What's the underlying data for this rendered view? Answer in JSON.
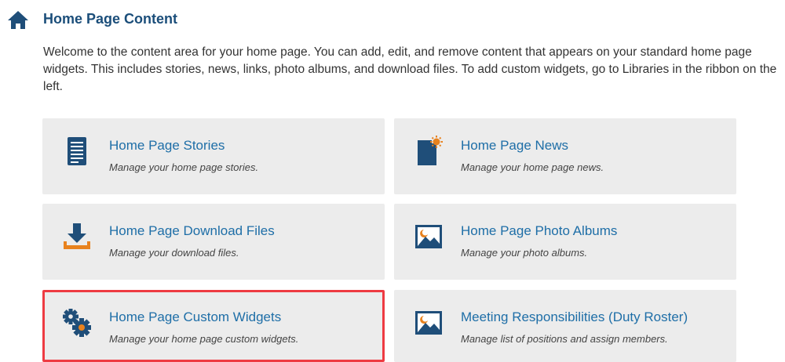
{
  "header": {
    "title": "Home Page Content",
    "intro": "Welcome to the content area for your home page. You can add, edit, and remove content that appears on your standard home page widgets. This includes stories, news, links, photo albums, and download files. To add custom widgets, go to Libraries in the ribbon on the left."
  },
  "cards": [
    {
      "title": "Home Page Stories",
      "desc": "Manage your home page stories.",
      "icon": "document-icon"
    },
    {
      "title": "Home Page News",
      "desc": "Manage your home page news.",
      "icon": "news-icon"
    },
    {
      "title": "Home Page Download Files",
      "desc": "Manage your download files.",
      "icon": "download-icon"
    },
    {
      "title": "Home Page Photo Albums",
      "desc": "Manage your photo albums.",
      "icon": "photo-icon"
    },
    {
      "title": "Home Page Custom Widgets",
      "desc": "Manage your home page custom widgets.",
      "icon": "gears-icon"
    },
    {
      "title": "Meeting Responsibilities (Duty Roster)",
      "desc": "Manage list of positions and assign members.",
      "icon": "photo-icon"
    }
  ],
  "colors": {
    "accent_blue": "#1e6ea7",
    "icon_navy": "#1f4e79",
    "icon_orange": "#e8821e",
    "highlight_red": "#ee3b42",
    "card_bg": "#ececec"
  }
}
